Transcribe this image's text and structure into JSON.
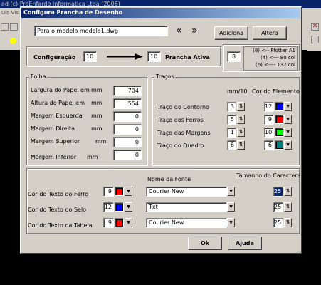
{
  "bg_app": {
    "title": "ad (c) ProEnfardo Informatica Ltda (2006)",
    "menu": "Ulo Visu"
  },
  "dialog": {
    "title": "Configura Prancha de Desenho",
    "model_field": "Para o modelo modelo1.dwg",
    "prev_label": "«",
    "next_label": "»",
    "adiciona_label": "Adiciona",
    "altera_label": "Altera",
    "config_label": "Configuração",
    "config_value": "10",
    "prancha_value": "10",
    "prancha_label": "Prancha Ativa",
    "plotter_value": "8",
    "plotter_options": [
      "(8)  <-- Plotter A1",
      "(4)  <---  80 col",
      "(6)  <----  132 col"
    ]
  },
  "folha": {
    "title": "Folha",
    "rows": [
      {
        "label": "Largura do Papel em",
        "unit": "mm",
        "value": "704"
      },
      {
        "label": "Altura do Papel em",
        "unit": "mm",
        "value": "554"
      },
      {
        "label": "Margem Esquerda",
        "unit": "mm",
        "value": "0"
      },
      {
        "label": "Margem Direita",
        "unit": "mm",
        "value": "0"
      },
      {
        "label": "Margem Superior",
        "unit": "mm",
        "value": "0"
      },
      {
        "label": "Margem Inferior",
        "unit": "mm",
        "value": "0"
      }
    ]
  },
  "tracos": {
    "title": "Traços",
    "col_mm": "mm/10",
    "col_cor": "Cor do Elemento",
    "rows": [
      {
        "label": "Traço do Contorno",
        "mm": "3",
        "cor": "12",
        "color": "#0000ff"
      },
      {
        "label": "Traço dos Ferros",
        "mm": "5",
        "cor": "9",
        "color": "#ff0000"
      },
      {
        "label": "Traço das Margens",
        "mm": "1",
        "cor": "10",
        "color": "#00ff00"
      },
      {
        "label": "Traço do Quadro",
        "mm": "6",
        "cor": "6",
        "color": "#008080"
      }
    ]
  },
  "texto": {
    "fonte_header": "Nome da Fonte",
    "tamanho_header": "Tamanho do Caractere",
    "rows": [
      {
        "label": "Cor do Texto do Ferro",
        "cor": "9",
        "color": "#ff0000",
        "font": "Courier New",
        "size": "25"
      },
      {
        "label": "Cor do Texto do Selo",
        "cor": "12",
        "color": "#0000ff",
        "font": "Txt",
        "size": "25"
      },
      {
        "label": "Cor do Texto da Tabela",
        "cor": "9",
        "color": "#ff0000",
        "font": "Courier New",
        "size": "25"
      }
    ]
  },
  "buttons": {
    "ok": "Ok",
    "ajuda": "Ajuda"
  }
}
